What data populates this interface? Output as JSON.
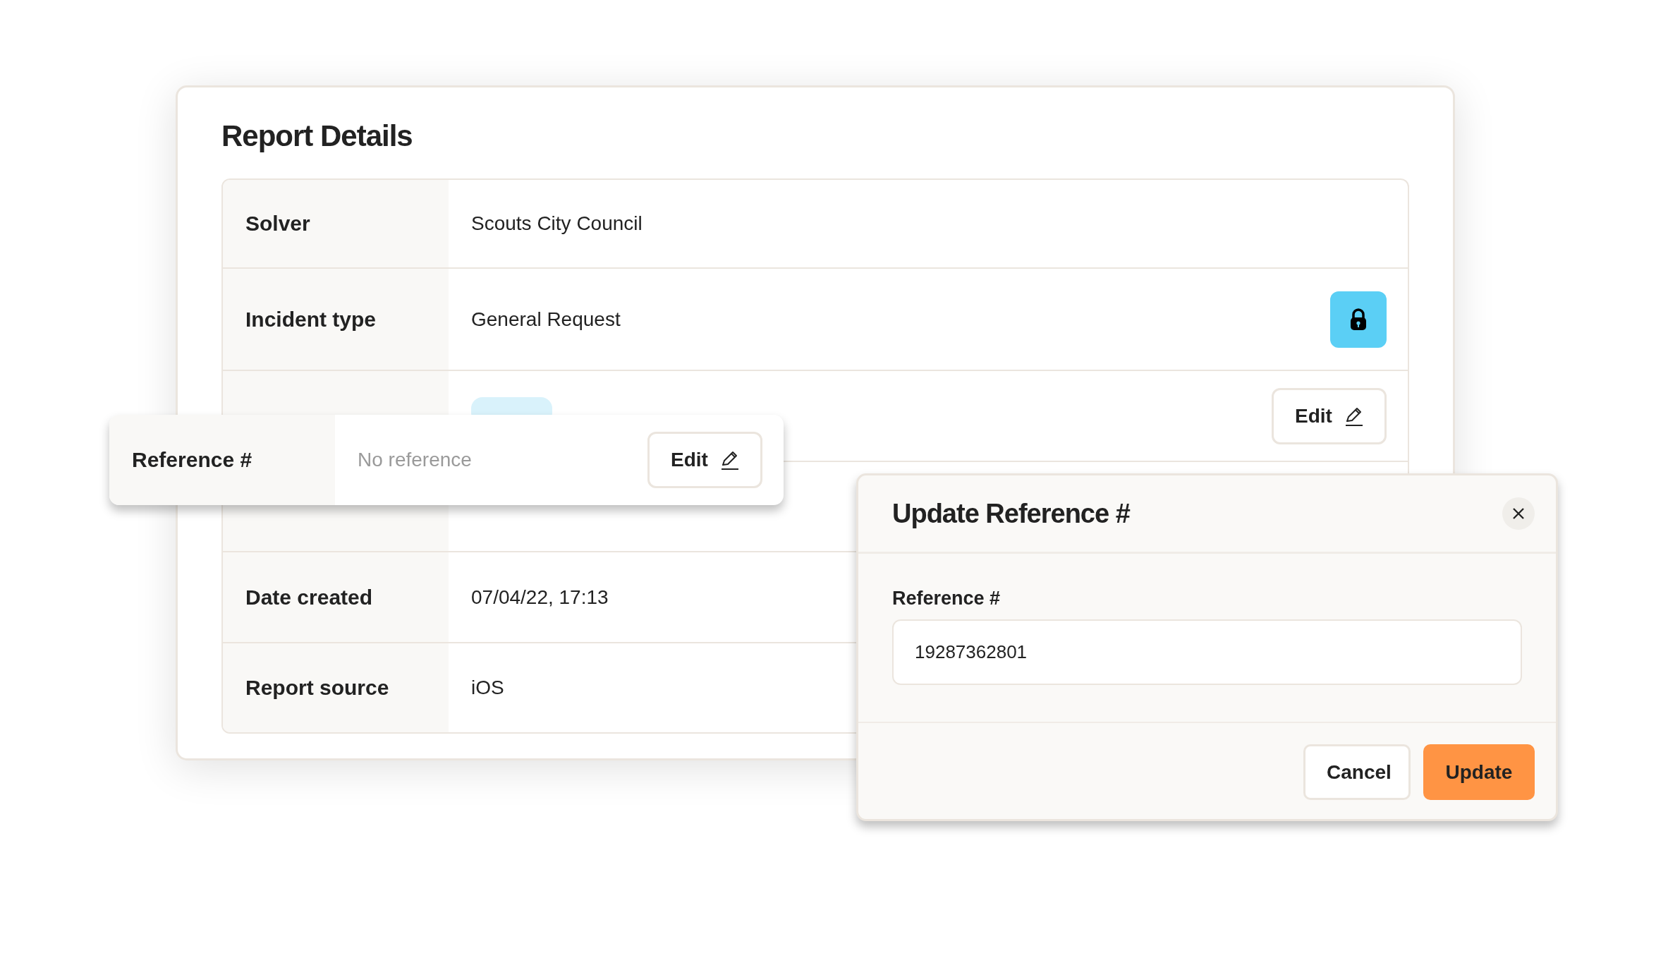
{
  "report": {
    "title": "Report Details",
    "rows": [
      {
        "label": "Solver",
        "kind": "text",
        "value": "Scouts City Council"
      },
      {
        "label": "Incident type",
        "kind": "text",
        "value": "General Request",
        "action": {
          "kind": "lock"
        }
      },
      {
        "kind": "badge",
        "action": {
          "kind": "edit",
          "label": "Edit"
        }
      },
      {
        "kind": "placeholder"
      },
      {
        "label": "Date created",
        "kind": "text",
        "value": "07/04/22, 17:13"
      },
      {
        "label": "Report source",
        "kind": "text",
        "value": "iOS"
      }
    ]
  },
  "floating_row": {
    "label": "Reference #",
    "kind": "placeholder",
    "value": "No reference",
    "action": {
      "kind": "edit",
      "label": "Edit"
    }
  },
  "dialog": {
    "title": "Update Reference #",
    "field_label": "Reference #",
    "value": "19287362801",
    "buttons": [
      {
        "label": "Cancel",
        "kind": "secondary"
      },
      {
        "label": "Update",
        "kind": "primary"
      }
    ]
  }
}
